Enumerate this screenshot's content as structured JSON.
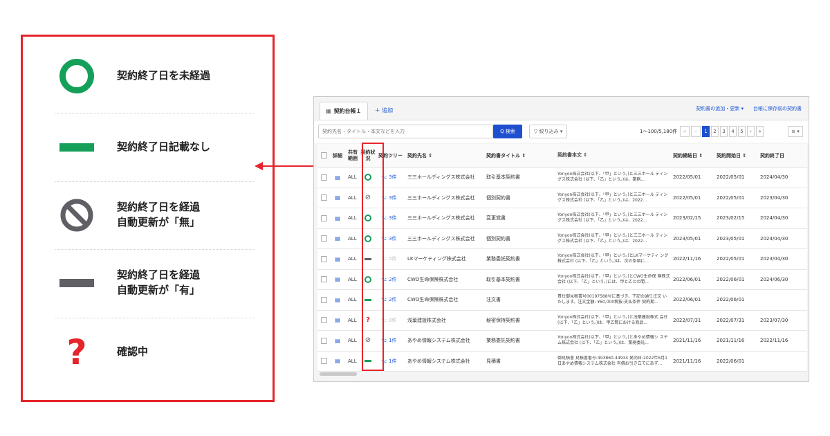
{
  "legend": {
    "items": [
      {
        "icon": "circle-outline-icon",
        "lines": [
          "契約終了日を未経過"
        ],
        "color": "#15a05a"
      },
      {
        "icon": "green-dash-icon",
        "lines": [
          "契約終了日記載なし"
        ],
        "color": "#15a05a"
      },
      {
        "icon": "prohibited-icon",
        "lines": [
          "契約終了日を経過",
          "自動更新が「無」"
        ],
        "color": "#5f5f65"
      },
      {
        "icon": "gray-dash-icon",
        "lines": [
          "契約終了日を経過",
          "自動更新が「有」"
        ],
        "color": "#5f5f65"
      },
      {
        "icon": "question-icon",
        "lines": [
          "確認中"
        ],
        "color": "#e5242b"
      }
    ]
  },
  "app": {
    "tab_label": "契約台帳１",
    "add_tab": "＋ 追加",
    "top_links": [
      "契約書の追加・更新 ▾",
      "台帳に保存前の契約書"
    ],
    "search_placeholder": "契約先名・タイトル・本文などを入力",
    "search_button": "Q 検索",
    "filter_button": "▽ 絞り込み ▾",
    "count": "1〜100/5,180件",
    "pager": [
      "«",
      "‹",
      "1",
      "2",
      "3",
      "4",
      "5",
      "›",
      "»"
    ],
    "view_button": "≡ ▾",
    "columns": {
      "detail": "詳細",
      "share": "共有範囲",
      "status": "契約状況",
      "tree": "契約ツリー",
      "party": "契約先名 ⇕",
      "title": "契約書タイトル ⇕",
      "body": "契約書本文 ⇕",
      "d1": "契約締結日 ⇕",
      "d2": "契約開始日 ⇕",
      "d3": "契約終了日"
    },
    "rows": [
      {
        "share": "ALL",
        "status": "ok",
        "tree": "3件",
        "party": "三三ホールディングス株式会社",
        "title": "取引基本契約書",
        "body": "Yonyon株式会社(以下、「甲」という。)と三三ホール ディングス株式会社 (以下、「乙」という。)は、業務...",
        "d1": "2022/05/01",
        "d2": "2022/05/01",
        "d3": "2024/04/30"
      },
      {
        "share": "ALL",
        "status": "prohib",
        "tree": "3件",
        "party": "三三ホールディングス株式会社",
        "title": "個別契約書",
        "body": "Yonyon株式会社(以下、「甲」という。)と三三ホール ディングス株式会社 (以下、「乙」という。)は、2022...",
        "d1": "2022/05/01",
        "d2": "2022/05/01",
        "d3": "2023/04/30"
      },
      {
        "share": "ALL",
        "status": "ok",
        "tree": "3件",
        "party": "三三ホールディングス株式会社",
        "title": "変更覚書",
        "body": "Yonyon株式会社(以下、「甲」という。)と三三ホール ディングス株式会社 (以下、「乙」という。)は、2022...",
        "d1": "2023/02/15",
        "d2": "2023/02/15",
        "d3": "2024/04/30"
      },
      {
        "share": "ALL",
        "status": "ok",
        "tree": "3件",
        "party": "三三ホールディングス株式会社",
        "title": "個別契約書",
        "body": "Yonyon株式会社(以下、「甲」という。)と三三ホール ディングス株式会社 (以下、「乙」という。)は、2022...",
        "d1": "2023/05/01",
        "d2": "2023/05/01",
        "d3": "2024/04/30"
      },
      {
        "share": "ALL",
        "status": "auto",
        "tree": "0件",
        "party": "LKマーケティング株式会社",
        "title": "業務委託契約書",
        "body": "Yonyon株式会社(以下、「甲」という。)とLKマーケティ ング株式会社 (以下、「乙」という。)は、次の条項に...",
        "d1": "2022/11/16",
        "d2": "2022/05/01",
        "d3": "2023/04/30"
      },
      {
        "share": "ALL",
        "status": "ok",
        "tree": "2件",
        "party": "CWO生命保険株式会社",
        "title": "取引基本契約書",
        "body": "Yonyon株式会社(以下、「甲」という。)とCWO生命保 険株式会社 (以下、「乙」という。)には、甲と乙との間...",
        "d1": "2022/06/01",
        "d2": "2022/06/01",
        "d3": "2024/06/30"
      },
      {
        "share": "ALL",
        "status": "none",
        "tree": "2件",
        "party": "CWO生命保険株式会社",
        "title": "注文書",
        "body": "貴社御見積書号00197588号に基づき、下記の通り注文 いたします。注文金額: ¥60,000税抜:支払条件 契約期...",
        "d1": "2022/06/01",
        "d2": "2022/06/01",
        "d3": ""
      },
      {
        "share": "ALL",
        "status": "check",
        "tree": "0件",
        "party": "浅葉建設株式会社",
        "title": "秘密保持契約書",
        "body": "Yonyon株式会社(以下、「甲」という。)と浅葉建設株式 会社 (以下、「乙」という。)は、甲乙間における商品...",
        "d1": "2022/07/31",
        "d2": "2022/07/31",
        "d3": "2023/07/30"
      },
      {
        "share": "ALL",
        "status": "prohib",
        "tree": "1件",
        "party": "あやめ情報システム株式会社",
        "title": "業務委託契約書",
        "body": "Yonyon株式会社(以下、「甲」という。)とあやめ情報シ ステム株式会社 (以下、「乙」という。)は、業務委託...",
        "d1": "2021/11/16",
        "d2": "2021/11/16",
        "d3": "2022/11/16"
      },
      {
        "share": "ALL",
        "status": "none",
        "tree": "1件",
        "party": "あやめ情報システム株式会社",
        "title": "見積書",
        "body": "御見積書 見積書番号:493860-44934 発効日:2022年6月1 日あやめ情報システム株式会社 有償お引き立てにあず...",
        "d1": "2021/11/16",
        "d2": "2022/06/01",
        "d3": ""
      }
    ]
  },
  "colors": {
    "accent_red": "#e5242b",
    "ok_green": "#15a05a",
    "gray": "#5f5f65",
    "primary_blue": "#1d4fcf"
  }
}
